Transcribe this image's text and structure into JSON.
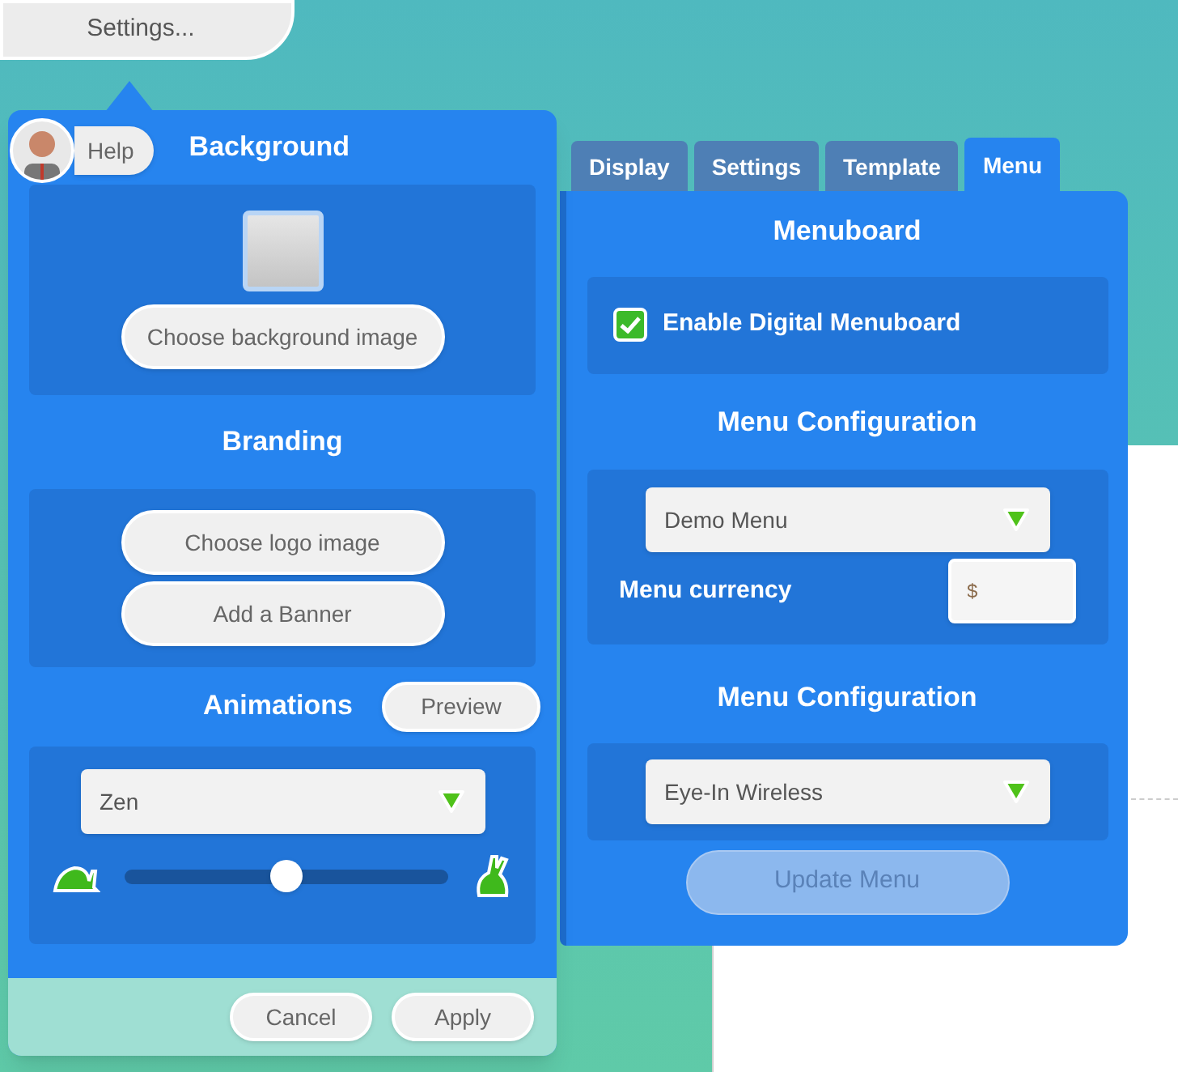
{
  "settings_button": "Settings...",
  "help_button": "Help",
  "background": {
    "title": "Background",
    "button": "Choose background image"
  },
  "branding": {
    "title": "Branding",
    "buttons": [
      "Choose logo image",
      "Add a Banner"
    ]
  },
  "animations": {
    "title": "Animations",
    "preview_button": "Preview",
    "dropdown": "Zen",
    "speed": {
      "level": 0.5
    }
  },
  "footer_buttons": [
    {
      "label": "Cancel"
    },
    {
      "label": "Apply"
    }
  ],
  "tabs": [
    {
      "label": "Display",
      "selected": false
    },
    {
      "label": "Settings",
      "selected": false
    },
    {
      "label": "Template",
      "selected": false
    },
    {
      "label": "Menu",
      "selected": true
    }
  ],
  "menuboard": {
    "title": "Menuboard",
    "enable": {
      "label": "Enable Digital Menuboard",
      "checked": true
    }
  },
  "menu_configuration": {
    "title": "Menu Configuration",
    "dropdown": "Demo Menu",
    "currency_label": "Menu currency",
    "currency_value": "$"
  },
  "menu_configuration_2": {
    "title": "Menu Configuration",
    "dropdown": "Eye-In Wireless"
  },
  "update_button": {
    "label": "Update Menu",
    "disabled": true
  }
}
